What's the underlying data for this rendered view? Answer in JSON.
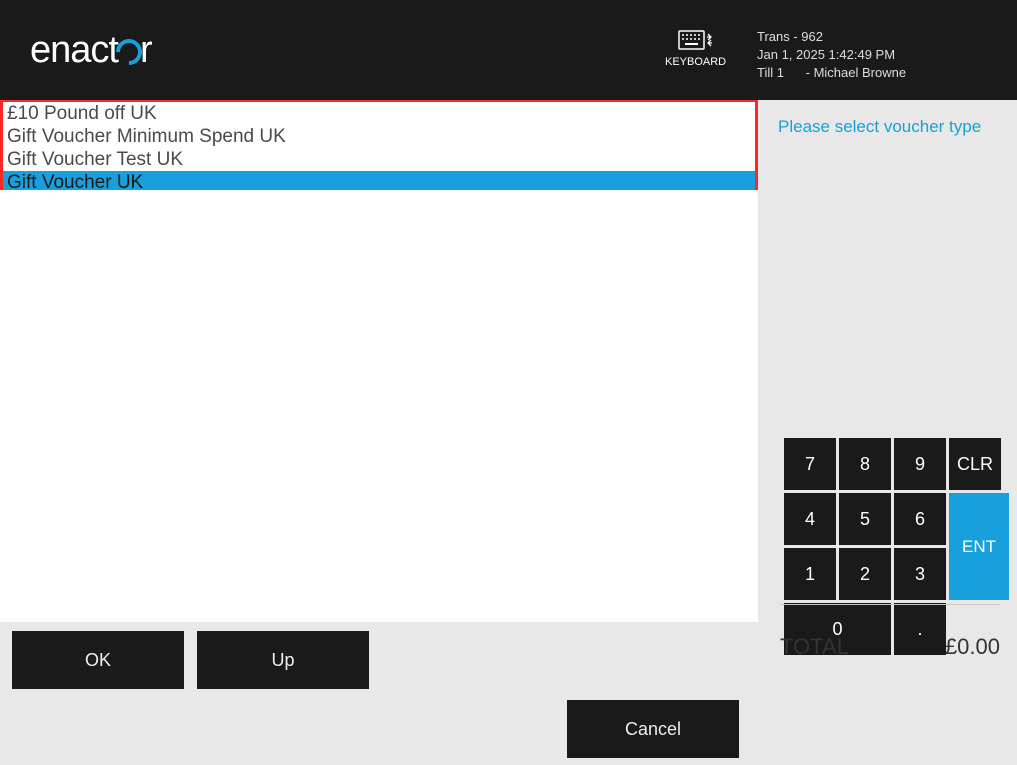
{
  "header": {
    "logo_text_1": "enact",
    "logo_text_2": "r",
    "keyboard_label": "KEYBOARD",
    "info": {
      "transaction": "Trans - 962",
      "datetime": "Jan 1, 2025 1:42:49 PM",
      "till": "Till 1",
      "sep": " - ",
      "operator": "Michael Browne"
    }
  },
  "prompt": "Please select voucher type",
  "voucher_list": [
    {
      "label": "£10 Pound off UK",
      "selected": false
    },
    {
      "label": "Gift Voucher Minimum Spend UK",
      "selected": false
    },
    {
      "label": "Gift Voucher Test UK",
      "selected": false
    },
    {
      "label": "Gift Voucher UK",
      "selected": true
    }
  ],
  "keypad": {
    "k7": "7",
    "k8": "8",
    "k9": "9",
    "clr": "CLR",
    "k4": "4",
    "k5": "5",
    "k6": "6",
    "k1": "1",
    "k2": "2",
    "k3": "3",
    "k0": "0",
    "kdot": ".",
    "ent": "ENT"
  },
  "total": {
    "label": "TOTAL",
    "value": "£0.00"
  },
  "buttons": {
    "ok": "OK",
    "up": "Up",
    "cancel": "Cancel"
  }
}
